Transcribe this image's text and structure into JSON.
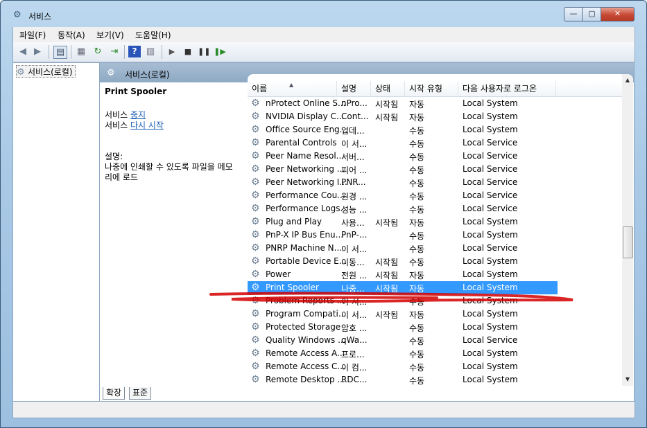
{
  "window": {
    "title": "서비스"
  },
  "controls": {
    "minimize": "—",
    "maximize": "▢",
    "close": "✕"
  },
  "menu": [
    "파일(F)",
    "동작(A)",
    "보기(V)",
    "도움말(H)"
  ],
  "tree": {
    "root": "서비스(로컬)"
  },
  "content_header": "서비스(로컬)",
  "detail": {
    "title": "Print Spooler",
    "stop_prefix": "서비스 ",
    "stop_link": "중지",
    "restart_prefix": "서비스 ",
    "restart_link": "다시 시작",
    "desc_label": "설명:",
    "desc_line1": "나중에 인쇄할 수 있도록 파일을 메모",
    "desc_line2": "리에 로드"
  },
  "columns": [
    "이름",
    "설명",
    "상태",
    "시작 유형",
    "다음 사용자로 로그온"
  ],
  "rows": [
    [
      "nProtect Online S...",
      "nPro...",
      "시작됨",
      "자동",
      "Local System"
    ],
    [
      "NVIDIA Display C...",
      "Cont...",
      "시작됨",
      "자동",
      "Local System"
    ],
    [
      "Office Source Eng...",
      "업데...",
      "",
      "수동",
      "Local System"
    ],
    [
      "Parental Controls",
      "이 서...",
      "",
      "수동",
      "Local Service"
    ],
    [
      "Peer Name Resol...",
      "서버...",
      "",
      "수동",
      "Local Service"
    ],
    [
      "Peer Networking ...",
      "피어 ...",
      "",
      "수동",
      "Local Service"
    ],
    [
      "Peer Networking I...",
      "PNR...",
      "",
      "수동",
      "Local Service"
    ],
    [
      "Performance Cou...",
      "원경 ...",
      "",
      "수동",
      "Local Service"
    ],
    [
      "Performance Logs...",
      "성능 ...",
      "",
      "수동",
      "Local Service"
    ],
    [
      "Plug and Play",
      "사용...",
      "시작됨",
      "자동",
      "Local System"
    ],
    [
      "PnP-X IP Bus Enu...",
      "PnP-...",
      "",
      "수동",
      "Local System"
    ],
    [
      "PNRP Machine N...",
      "이 서...",
      "",
      "수동",
      "Local Service"
    ],
    [
      "Portable Device E...",
      "이동...",
      "시작됨",
      "수동",
      "Local System"
    ],
    [
      "Power",
      "전원 ...",
      "시작됨",
      "자동",
      "Local System"
    ],
    [
      "Print Spooler",
      "나중...",
      "시작됨",
      "자동",
      "Local System"
    ],
    [
      "Problem Reports ...",
      "이 서...",
      "",
      "수동",
      "Local System"
    ],
    [
      "Program Compati...",
      "이 서...",
      "시작됨",
      "자동",
      "Local System"
    ],
    [
      "Protected Storage",
      "암호 ...",
      "",
      "수동",
      "Local System"
    ],
    [
      "Quality Windows ...",
      "qWa...",
      "",
      "수동",
      "Local Service"
    ],
    [
      "Remote Access A...",
      "프로...",
      "",
      "수동",
      "Local System"
    ],
    [
      "Remote Access C...",
      "이 컴...",
      "",
      "수동",
      "Local System"
    ],
    [
      "Remote Desktop ...",
      "RDC...",
      "",
      "수동",
      "Local System"
    ]
  ],
  "selected_row": 14,
  "tabs": [
    "확장",
    "표준"
  ],
  "colors": {
    "selection": "#3399ff",
    "annotation": "#d40000"
  }
}
